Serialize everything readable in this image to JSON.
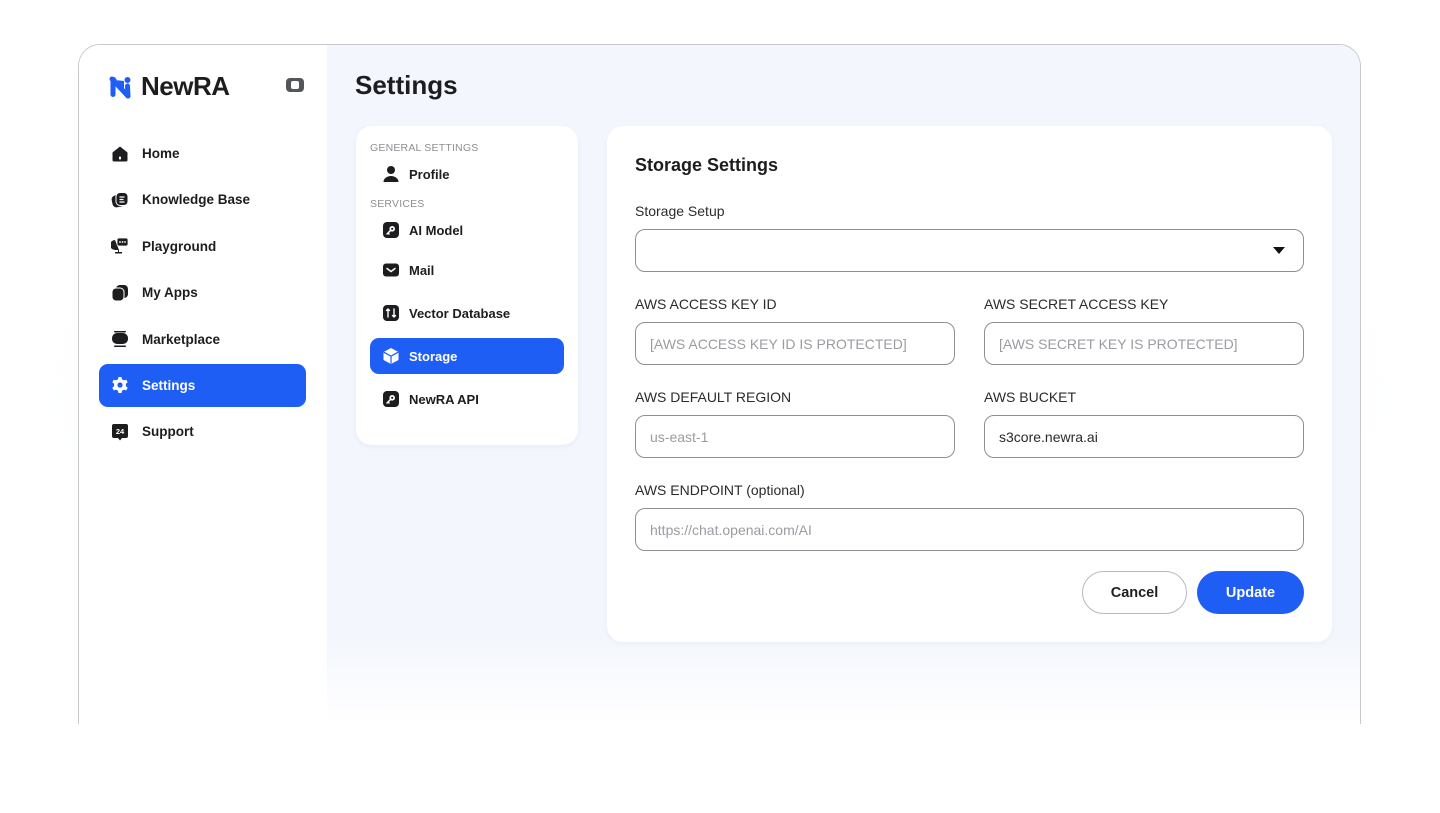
{
  "app": {
    "brand_name": "NewRA",
    "brand_color": "#1f5ef5"
  },
  "sidebar": {
    "collapse_icon": "sidebar-toggle-icon",
    "items": [
      {
        "label": "Home",
        "icon": "home-icon",
        "active": false
      },
      {
        "label": "Knowledge Base",
        "icon": "knowledge-base-icon",
        "active": false
      },
      {
        "label": "Playground",
        "icon": "playground-icon",
        "active": false
      },
      {
        "label": "My Apps",
        "icon": "apps-icon",
        "active": false
      },
      {
        "label": "Marketplace",
        "icon": "marketplace-icon",
        "active": false
      },
      {
        "label": "Settings",
        "icon": "gear-icon",
        "active": true
      },
      {
        "label": "Support",
        "icon": "support-24-icon",
        "active": false
      }
    ]
  },
  "main": {
    "title": "Settings",
    "sub_nav": {
      "sections": [
        {
          "heading": "GENERAL SETTINGS",
          "items": [
            {
              "label": "Profile",
              "icon": "user-icon",
              "active": false
            }
          ]
        },
        {
          "heading": "SERVICES",
          "items": [
            {
              "label": "AI Model",
              "icon": "key-icon",
              "active": false
            },
            {
              "label": "Mail",
              "icon": "mail-icon",
              "active": false
            },
            {
              "label": "Vector Database",
              "icon": "vector-database-icon",
              "active": false
            },
            {
              "label": "Storage",
              "icon": "cube-icon",
              "active": true
            },
            {
              "label": "NewRA API",
              "icon": "key-icon",
              "active": false
            }
          ]
        }
      ]
    },
    "panel": {
      "title": "Storage Settings",
      "storage_setup": {
        "label": "Storage Setup",
        "value": ""
      },
      "access_key_id": {
        "label": "AWS ACCESS KEY ID",
        "value": "",
        "placeholder": "[AWS ACCESS KEY ID IS PROTECTED]"
      },
      "secret_access_key": {
        "label": "AWS SECRET ACCESS KEY",
        "value": "",
        "placeholder": "[AWS SECRET KEY IS PROTECTED]"
      },
      "default_region": {
        "label": "AWS DEFAULT REGION",
        "value": "",
        "placeholder": "us-east-1"
      },
      "bucket": {
        "label": "AWS BUCKET",
        "value": "s3core.newra.ai",
        "placeholder": ""
      },
      "endpoint": {
        "label": "AWS ENDPOINT (optional)",
        "value": "",
        "placeholder": "https://chat.openai.com/AI"
      },
      "cancel_label": "Cancel",
      "update_label": "Update"
    }
  }
}
